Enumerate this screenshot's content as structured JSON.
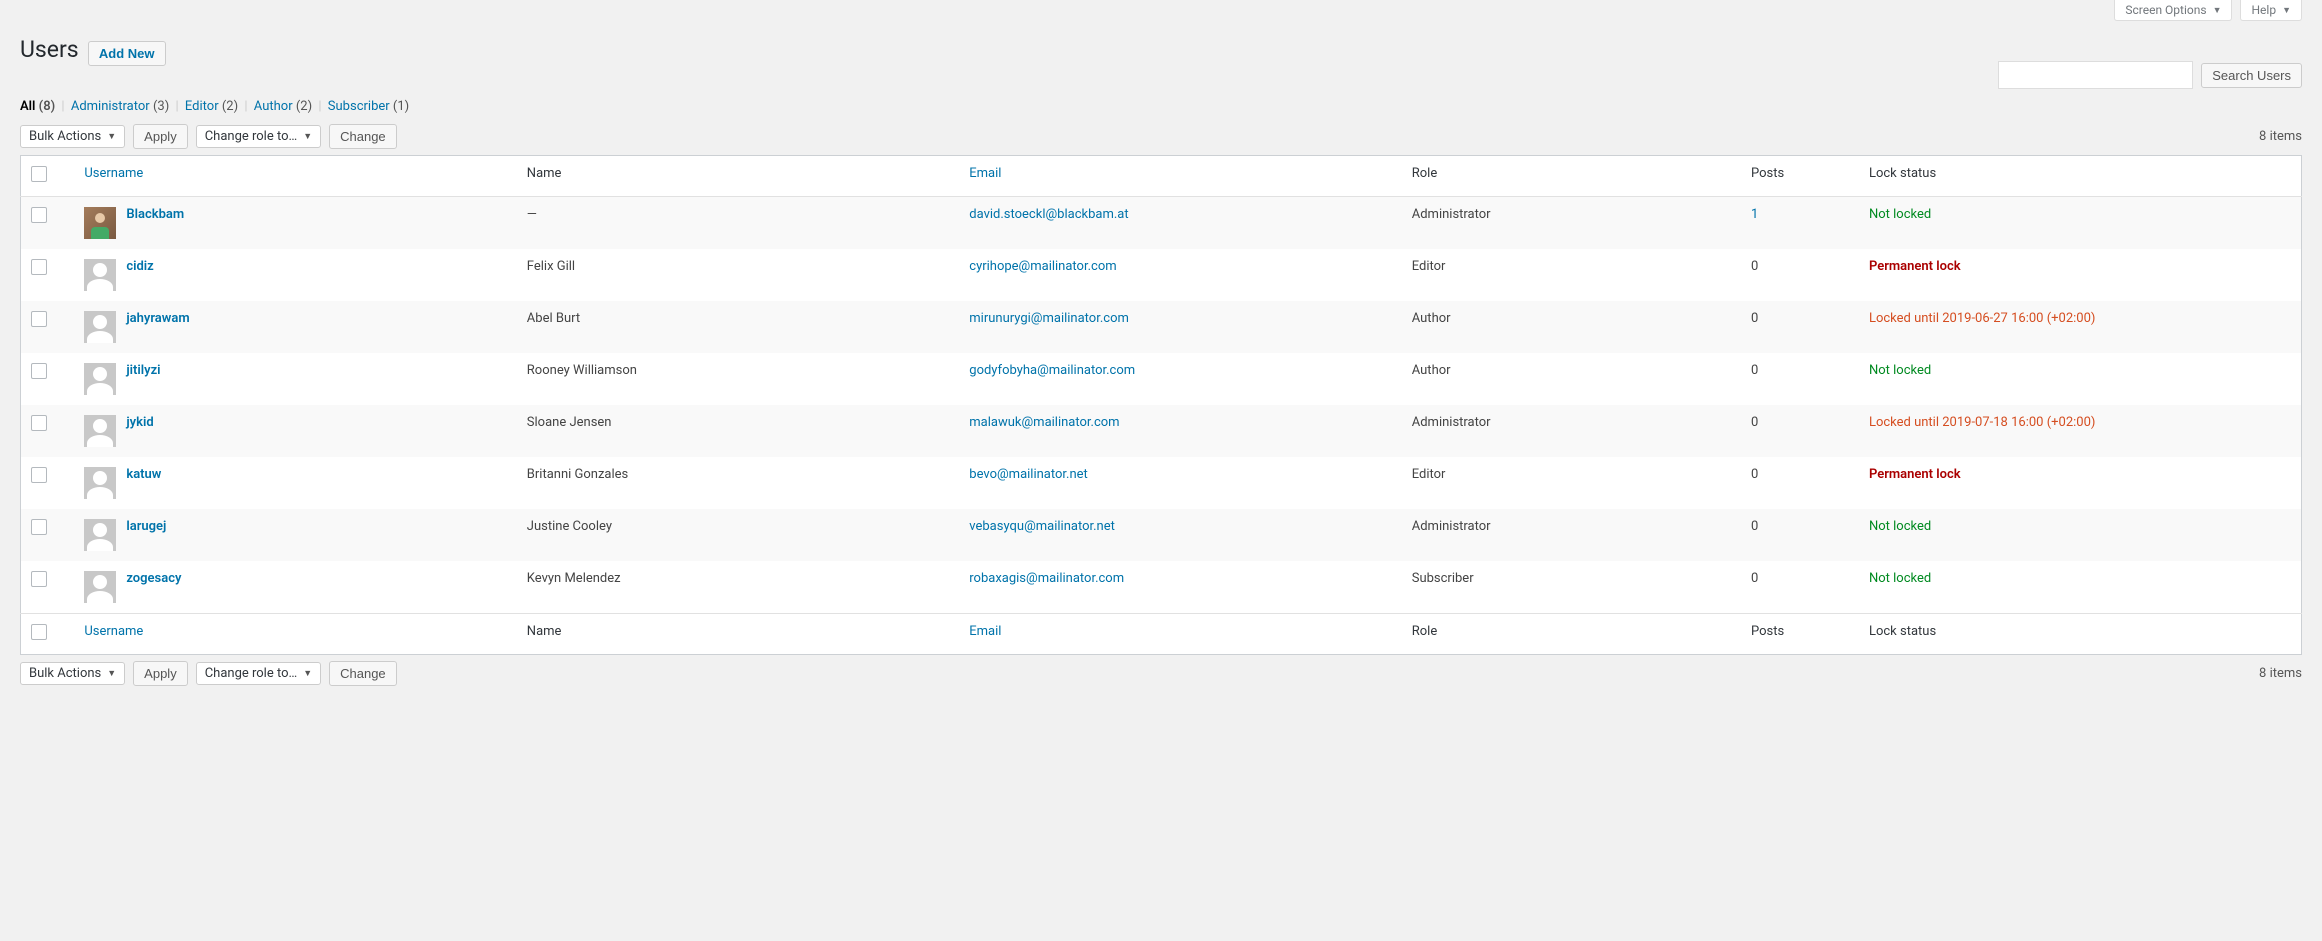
{
  "screen_tabs": {
    "screen_options": "Screen Options",
    "help": "Help"
  },
  "header": {
    "title": "Users",
    "add_new": "Add New"
  },
  "filters": {
    "all_label": "All",
    "all_count": "(8)",
    "administrator_label": "Administrator",
    "administrator_count": "(3)",
    "editor_label": "Editor",
    "editor_count": "(2)",
    "author_label": "Author",
    "author_count": "(2)",
    "subscriber_label": "Subscriber",
    "subscriber_count": "(1)"
  },
  "search": {
    "button": "Search Users"
  },
  "bulk": {
    "top": {
      "bulk_select": "Bulk Actions",
      "apply": "Apply",
      "role_select": "Change role to…",
      "change": "Change"
    },
    "bottom": {
      "bulk_select": "Bulk Actions",
      "apply": "Apply",
      "role_select": "Change role to…",
      "change": "Change"
    }
  },
  "items_count_top": "8 items",
  "items_count_bottom": "8 items",
  "columns": {
    "username": "Username",
    "name": "Name",
    "email": "Email",
    "role": "Role",
    "posts": "Posts",
    "lock": "Lock status"
  },
  "rows": [
    {
      "username": "Blackbam",
      "avatar": "photo",
      "name": "—",
      "email": "david.stoeckl@blackbam.at",
      "role": "Administrator",
      "posts": "1",
      "posts_link": true,
      "lock": "Not locked",
      "lock_class": "lock-green"
    },
    {
      "username": "cidiz",
      "avatar": "default",
      "name": "Felix Gill",
      "email": "cyrihope@mailinator.com",
      "role": "Editor",
      "posts": "0",
      "posts_link": false,
      "lock": "Permanent lock",
      "lock_class": "lock-red"
    },
    {
      "username": "jahyrawam",
      "avatar": "default",
      "name": "Abel Burt",
      "email": "mirunurygi@mailinator.com",
      "role": "Author",
      "posts": "0",
      "posts_link": false,
      "lock": "Locked until 2019-06-27 16:00 (+02:00)",
      "lock_class": "lock-orange"
    },
    {
      "username": "jitilyzi",
      "avatar": "default",
      "name": "Rooney Williamson",
      "email": "godyfobyha@mailinator.com",
      "role": "Author",
      "posts": "0",
      "posts_link": false,
      "lock": "Not locked",
      "lock_class": "lock-green"
    },
    {
      "username": "jykid",
      "avatar": "default",
      "name": "Sloane Jensen",
      "email": "malawuk@mailinator.com",
      "role": "Administrator",
      "posts": "0",
      "posts_link": false,
      "lock": "Locked until 2019-07-18 16:00 (+02:00)",
      "lock_class": "lock-orange"
    },
    {
      "username": "katuw",
      "avatar": "default",
      "name": "Britanni Gonzales",
      "email": "bevo@mailinator.net",
      "role": "Editor",
      "posts": "0",
      "posts_link": false,
      "lock": "Permanent lock",
      "lock_class": "lock-red"
    },
    {
      "username": "larugej",
      "avatar": "default",
      "name": "Justine Cooley",
      "email": "vebasyqu@mailinator.net",
      "role": "Administrator",
      "posts": "0",
      "posts_link": false,
      "lock": "Not locked",
      "lock_class": "lock-green"
    },
    {
      "username": "zogesacy",
      "avatar": "default",
      "name": "Kevyn Melendez",
      "email": "robaxagis@mailinator.com",
      "role": "Subscriber",
      "posts": "0",
      "posts_link": false,
      "lock": "Not locked",
      "lock_class": "lock-green"
    }
  ]
}
